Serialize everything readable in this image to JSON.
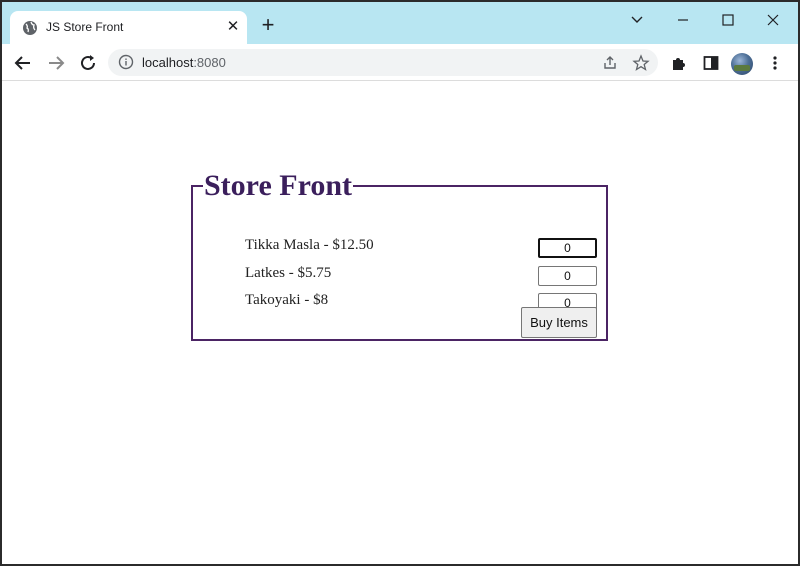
{
  "browser": {
    "tab": {
      "title": "JS Store Front",
      "close_label": "✕"
    },
    "new_tab_label": "+",
    "url_host": "localhost",
    "url_port": ":8080"
  },
  "store": {
    "legend": "Store Front",
    "items": [
      {
        "label": "Tikka Masla - $12.50",
        "quantity": "0"
      },
      {
        "label": "Latkes - $5.75",
        "quantity": "0"
      },
      {
        "label": "Takoyaki - $8",
        "quantity": "0"
      }
    ],
    "buy_label": "Buy Items"
  },
  "colors": {
    "tabstrip": "#b8e6f2",
    "legend": "#3b1f5c",
    "border": "#4b2464"
  }
}
